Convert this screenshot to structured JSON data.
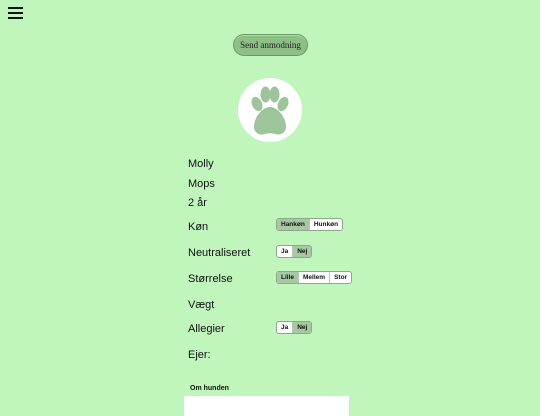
{
  "header": {
    "menu_icon": "hamburger-menu-icon",
    "request_button_label": "Send anmodning"
  },
  "profile": {
    "avatar_icon": "paw-print-icon",
    "name": "Molly",
    "breed": "Mops",
    "age": "2 år"
  },
  "fields": {
    "gender": {
      "label": "Køn",
      "options": [
        "Hankøn",
        "Hunkøn"
      ],
      "selected": "Hankøn"
    },
    "neutered": {
      "label": "Neutraliseret",
      "options": [
        "Ja",
        "Nej"
      ],
      "selected": "Nej"
    },
    "size": {
      "label": "Størrelse",
      "options": [
        "Lille",
        "Mellem",
        "Stor"
      ],
      "selected": "Lille"
    },
    "weight": {
      "label": "Vægt"
    },
    "allergies": {
      "label": "Allegier",
      "options": [
        "Ja",
        "Nej"
      ],
      "selected": "Nej"
    },
    "owner": {
      "label": "Ejer:"
    }
  },
  "about": {
    "label": "Om hunden"
  },
  "colors": {
    "background": "#c0f5bc",
    "button": "#8dbf86",
    "selected_option": "#a7c8a3",
    "paw": "#9dc49a"
  }
}
